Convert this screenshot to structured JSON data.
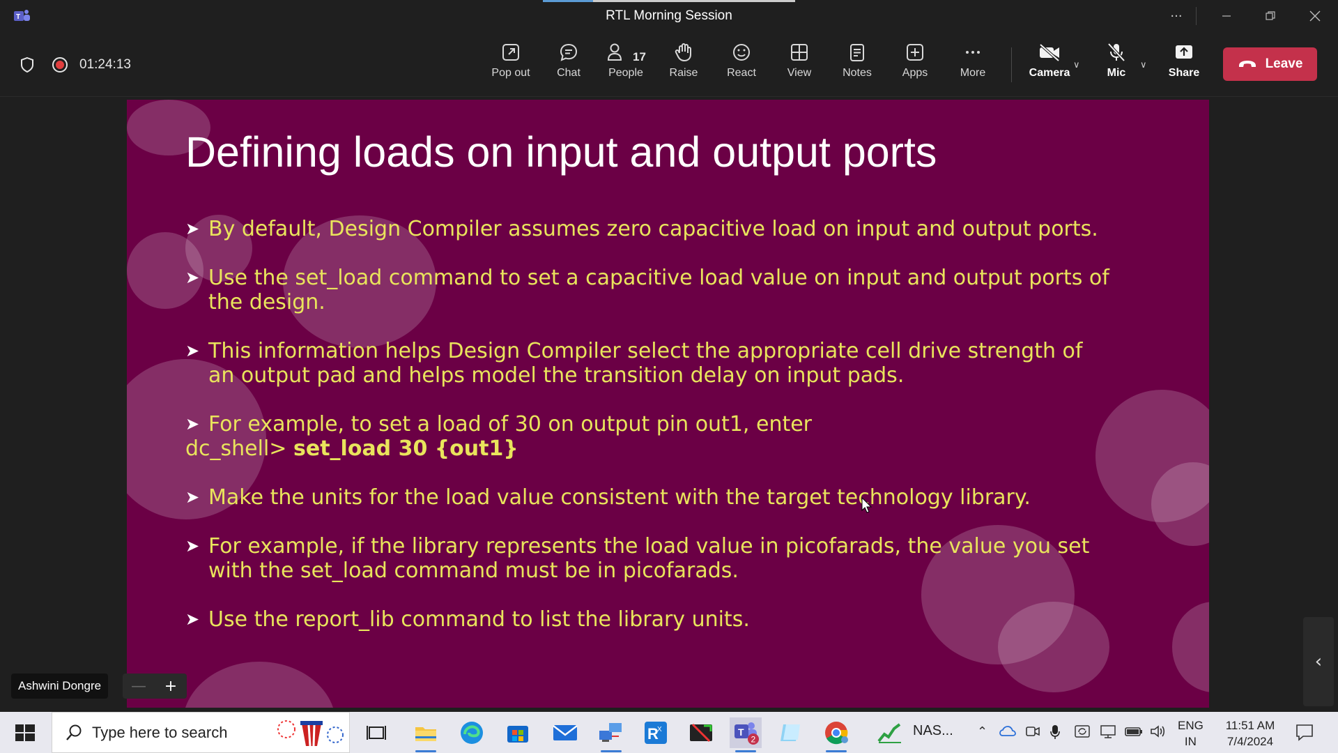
{
  "window": {
    "title": "RTL Morning Session",
    "controls": [
      "more-options",
      "minimize",
      "restore",
      "close"
    ]
  },
  "meeting": {
    "timer": "01:24:13",
    "people_count": "17",
    "toolbar": {
      "pop_out": "Pop out",
      "chat": "Chat",
      "people": "People",
      "raise": "Raise",
      "react": "React",
      "view": "View",
      "notes": "Notes",
      "apps": "Apps",
      "more": "More",
      "camera": "Camera",
      "mic": "Mic",
      "share": "Share",
      "leave": "Leave"
    },
    "presenter_name": "Ashwini Dongre",
    "colors": {
      "leave": "#c4314b",
      "slide_bg": "#6b0045",
      "bullet_text": "#e9e45c"
    }
  },
  "slide": {
    "title": "Defining loads on input and output ports",
    "bullets": [
      {
        "lines": [
          "By default, Design Compiler assumes zero capacitive load on input and output ports."
        ]
      },
      {
        "lines": [
          "Use the set_load command to set a capacitive load value on input and output ports of",
          "the design."
        ]
      },
      {
        "lines": [
          "This information helps Design Compiler select the appropriate cell drive strength of",
          "an output pad and helps model the transition delay on input pads."
        ]
      },
      {
        "lines": [
          "For example, to set a load of 30 on output pin out1, enter"
        ],
        "prompt": "dc_shell>",
        "command": "set_load 30 {out1}"
      },
      {
        "lines": [
          "Make the units for the load value consistent with the target technology library."
        ]
      },
      {
        "lines": [
          "For example, if the library represents the load value in picofarads, the value you set",
          "with the set_load command must be in picofarads."
        ]
      },
      {
        "lines": [
          "Use the report_lib command to list the library units."
        ]
      }
    ]
  },
  "taskbar": {
    "search_placeholder": "Type here to search",
    "nas_label": "NAS...",
    "teams_badge": "2",
    "lang_top": "ENG",
    "lang_bottom": "IN",
    "time": "11:51 AM",
    "date": "7/4/2024"
  }
}
